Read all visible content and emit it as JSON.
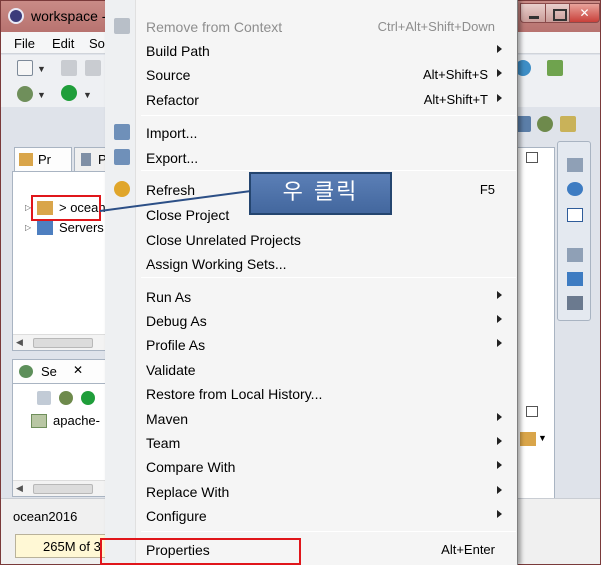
{
  "window": {
    "title": "workspace - "
  },
  "menubar": {
    "items": [
      "File",
      "Edit",
      "Sou"
    ]
  },
  "views": {
    "explorer_tabs": [
      "Pr",
      "Pa"
    ],
    "tree": [
      {
        "label": "> ocean"
      },
      {
        "label": "Servers"
      }
    ],
    "servers_tab": "Se",
    "servers_tree": [
      {
        "label": "apache-"
      }
    ]
  },
  "status": {
    "project": "ocean2016",
    "heap": "265M of 3"
  },
  "context_menu": {
    "items": [
      {
        "label": "Remove from Context",
        "shortcut": "Ctrl+Alt+Shift+Down",
        "disabled": true,
        "submenu": false,
        "icon": "remove-context-icon"
      },
      {
        "label": "Build Path",
        "shortcut": "",
        "disabled": false,
        "submenu": true
      },
      {
        "label": "Source",
        "shortcut": "Alt+Shift+S",
        "disabled": false,
        "submenu": true
      },
      {
        "label": "Refactor",
        "shortcut": "Alt+Shift+T",
        "disabled": false,
        "submenu": true
      },
      {
        "label": "Import...",
        "shortcut": "",
        "disabled": false,
        "submenu": false,
        "icon": "import-icon"
      },
      {
        "label": "Export...",
        "shortcut": "",
        "disabled": false,
        "submenu": false,
        "icon": "export-icon"
      },
      {
        "label": "Refresh",
        "shortcut": "F5",
        "disabled": false,
        "submenu": false,
        "icon": "refresh-icon"
      },
      {
        "label": "Close Project",
        "shortcut": "",
        "disabled": false,
        "submenu": false
      },
      {
        "label": "Close Unrelated Projects",
        "shortcut": "",
        "disabled": false,
        "submenu": false
      },
      {
        "label": "Assign Working Sets...",
        "shortcut": "",
        "disabled": false,
        "submenu": false
      },
      {
        "label": "Run As",
        "shortcut": "",
        "disabled": false,
        "submenu": true
      },
      {
        "label": "Debug As",
        "shortcut": "",
        "disabled": false,
        "submenu": true
      },
      {
        "label": "Profile As",
        "shortcut": "",
        "disabled": false,
        "submenu": true
      },
      {
        "label": "Validate",
        "shortcut": "",
        "disabled": false,
        "submenu": false
      },
      {
        "label": "Restore from Local History...",
        "shortcut": "",
        "disabled": false,
        "submenu": false
      },
      {
        "label": "Maven",
        "shortcut": "",
        "disabled": false,
        "submenu": true
      },
      {
        "label": "Team",
        "shortcut": "",
        "disabled": false,
        "submenu": true
      },
      {
        "label": "Compare With",
        "shortcut": "",
        "disabled": false,
        "submenu": true
      },
      {
        "label": "Replace With",
        "shortcut": "",
        "disabled": false,
        "submenu": true
      },
      {
        "label": "Configure",
        "shortcut": "",
        "disabled": false,
        "submenu": true
      },
      {
        "label": "Properties",
        "shortcut": "Alt+Enter",
        "disabled": false,
        "submenu": false
      }
    ]
  },
  "annotation": {
    "callout_text": "우 클릭",
    "highlight_color": "#e0161b",
    "callout_color": "#4f73aa"
  }
}
